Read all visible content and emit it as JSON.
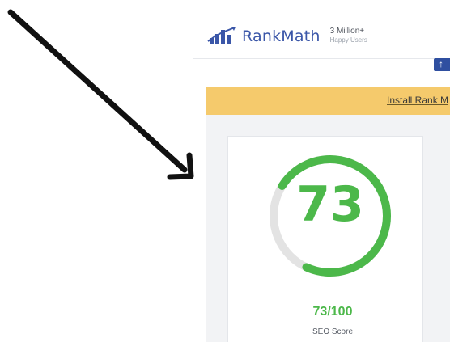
{
  "header": {
    "brand": "RankMath",
    "users_count": "3 Million+",
    "users_label": "Happy Users",
    "logo_icon": "rankmath-logo-icon"
  },
  "notice": {
    "text": "Install Rank M"
  },
  "score_card": {
    "score": "73",
    "fraction": "73/100",
    "caption": "SEO Score",
    "progress": 0.73
  },
  "annotation": {
    "icon": "pointer-arrow-icon"
  },
  "colors": {
    "brand_blue": "#3a56a8",
    "notice_yellow": "#f5ca6c",
    "score_green": "#4cb84a",
    "track_gray": "#e3e3e3",
    "content_bg": "#f2f3f5"
  }
}
